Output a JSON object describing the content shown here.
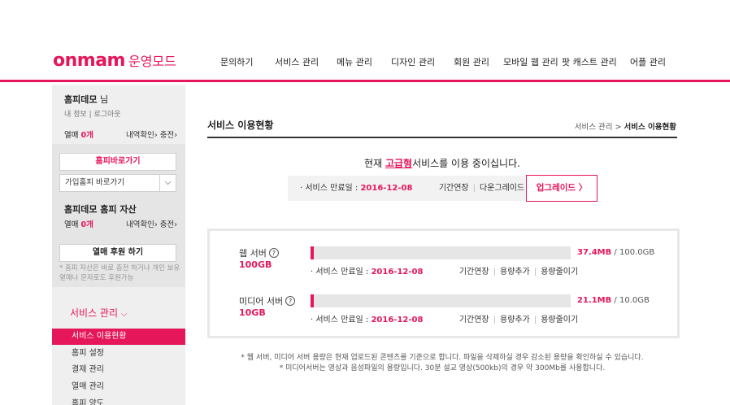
{
  "header": {
    "logo_brand": "onmam",
    "logo_sub": "운영모드",
    "nav": [
      "문의하기",
      "서비스 관리",
      "메뉴 관리",
      "디자인 관리",
      "회원 관리",
      "모바일 웹 관리",
      "팟 캐스트 관리",
      "어플 관리"
    ]
  },
  "sidebar": {
    "user_name": "홈피데모",
    "user_suffix": " 님",
    "link_info": "내 정보",
    "link_sep": " | ",
    "link_logout": "로그아웃",
    "heart_label": "열매 ",
    "heart_count": "0개",
    "heart_action": "내역확인› 충전›",
    "home_button": "홈피바로가기",
    "select_value": "가입홈피 바로가기",
    "asset_title": "홈피데모 홈피 자산",
    "asset_label": "열매 ",
    "asset_count": "0개",
    "asset_action": "내역확인› 충전›",
    "support_button": "열매 후원 하기",
    "support_note": "* 홈피 자산은 바로 충전 하거나 개인 보유 열매나 문자로도 후원가능",
    "menu_title": "서비스 관리",
    "menu_items": [
      "서비스 이용현황",
      "홈피 설정",
      "결제 관리",
      "열매 관리",
      "홈피 양도"
    ]
  },
  "main": {
    "title": "서비스 이용현황",
    "crumb_parent": "서비스 관리 > ",
    "crumb_current": "서비스 이용현황",
    "status_prefix": "현재 ",
    "status_grade": "고급형",
    "status_suffix": "서비스를 이용 중이십니다.",
    "expire_label": "· 서비스 만료일 : ",
    "expire_date": "2016-12-08",
    "extend": "기간연장",
    "downgrade": "다운그레이드",
    "upgrade": "업그레이드 〉"
  },
  "servers": [
    {
      "name": "웹 서버",
      "size": "100GB",
      "used": "37.4MB",
      "total": " / 100.0GB",
      "usage_ratio": 0.012,
      "expire_label": "· 서비스 만료일 : ",
      "expire_date": "2016-12-08",
      "link_extend": "기간연장",
      "link_add": "용량추가",
      "link_reduce": "용량줄이기"
    },
    {
      "name": "미디어 서버",
      "size": "10GB",
      "used": "21.1MB",
      "total": " / 10.0GB",
      "usage_ratio": 0.012,
      "expire_label": "· 서비스 만료일 : ",
      "expire_date": "2016-12-08",
      "link_extend": "기간연장",
      "link_add": "용량추가",
      "link_reduce": "용량줄이기"
    }
  ],
  "footnotes": [
    "* 웹 서버, 미디어 서버 용량은 현재 업로드된 콘텐츠를 기준으로 합니다. 파일을 삭제하실 경우 감소된 용량을 확인하실 수 있습니다.",
    "* 미디어서버는 영상과 음성파일의 용량입니다. 30분 설교 영상(500kb)의 경우 약 300Mb를 사용합니다."
  ],
  "colors": {
    "accent": "#e5165a"
  }
}
